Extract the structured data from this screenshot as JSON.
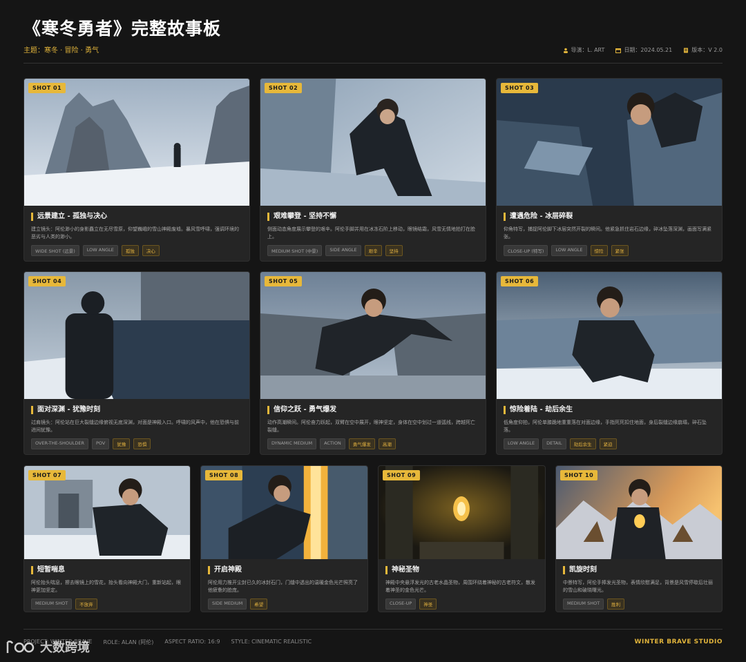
{
  "header": {
    "title": "《寒冬勇者》完整故事板",
    "subtitle": "主题：寒冬 · 冒险 · 勇气",
    "director": "导演：L. ART",
    "date": "日期：2024.05.21",
    "version": "版本：V 2.0"
  },
  "colors": {
    "accent": "#e7b83a",
    "background": "#151515",
    "card": "#252525"
  },
  "shots": [
    {
      "badge": "SHOT 01",
      "title": "远景建立 - 孤独与决心",
      "desc": "建立镜头：阿伦渺小的身影矗立在无尽雪原，仰望巍峨的雪山神殿废墟。暴风雪呼啸，强调环境的恶劣与人类的渺小。",
      "tags": [
        "WIDE SHOT (远景)",
        "LOW ANGLE"
      ],
      "gold": [
        "孤独",
        "决心"
      ]
    },
    {
      "badge": "SHOT 02",
      "title": "艰难攀登 - 坚持不懈",
      "desc": "侧面动态角度展示攀登的艰辛。阿伦手脚并用在冰冻石阶上移动，眼镜结霜，风雪无情地拍打在脸上。",
      "tags": [
        "MEDIUM SHOT (中景)",
        "SIDE ANGLE"
      ],
      "gold": [
        "艰辛",
        "坚持"
      ]
    },
    {
      "badge": "SHOT 03",
      "title": "遭遇危险 - 冰层碎裂",
      "desc": "仰角特写，捕捉阿伦脚下冰层突然开裂的瞬间。他紧急抓住岩石边缘，碎冰坠落深渊，画面写满紧张。",
      "tags": [
        "CLOSE-UP (特写)",
        "LOW ANGLE"
      ],
      "gold": [
        "惊险",
        "紧张"
      ]
    },
    {
      "badge": "SHOT 04",
      "title": "面对深渊 - 犹豫时刻",
      "desc": "过肩镜头：阿伦站在巨大裂缝边缘俯视无底深渊，对面是神殿入口。呼啸的风声中，他在恐惧与前进间犹豫。",
      "tags": [
        "OVER-THE-SHOULDER",
        "POV"
      ],
      "gold": [
        "犹豫",
        "恐惧"
      ]
    },
    {
      "badge": "SHOT 05",
      "title": "信仰之跃 - 勇气爆发",
      "desc": "动作高潮瞬间。阿伦奋力跃起，双臂在空中展开，眼神坚定，身体在空中划过一道弧线，跨越死亡裂缝。",
      "tags": [
        "DYNAMIC MEDIUM",
        "ACTION"
      ],
      "gold": [
        "勇气爆发",
        "高潮"
      ]
    },
    {
      "badge": "SHOT 06",
      "title": "惊险着陆 - 劫后余生",
      "desc": "低角度仰拍，阿伦单膝跪地重重落在对面边缘，手指死死扣住地面，身后裂缝边缘崩塌，碎石坠落。",
      "tags": [
        "LOW ANGLE",
        "DETAIL"
      ],
      "gold": [
        "劫后余生",
        "紧迫"
      ]
    },
    {
      "badge": "SHOT 07",
      "title": "短暂喘息",
      "desc": "阿伦抬头喘息，擦去眼镜上的雪花，抬头看向神殿大门，重新站起，眼神更加坚定。",
      "tags": [
        "MEDIUM SHOT"
      ],
      "gold": [
        "不放弃"
      ]
    },
    {
      "badge": "SHOT 08",
      "title": "开启神殿",
      "desc": "阿伦用力推开尘封已久的冰封石门，门缝中透出的温暖金色光芒照亮了他疲惫的脸庞。",
      "tags": [
        "SIDE MEDIUM"
      ],
      "gold": [
        "希望"
      ]
    },
    {
      "badge": "SHOT 09",
      "title": "神秘圣物",
      "desc": "神殿中央悬浮发光的古老水晶圣物，周围环绕着神秘的古老符文，散发着神圣的金色光芒。",
      "tags": [
        "CLOSE-UP"
      ],
      "gold": [
        "神圣"
      ]
    },
    {
      "badge": "SHOT 10",
      "title": "凯旋时刻",
      "desc": "中景特写，阿伦手捧发光圣物，表情欣慰满足，背景是风雪停歇后壮丽的雪山和破晓曙光。",
      "tags": [
        "MEDIUM SHOT"
      ],
      "gold": [
        "胜利"
      ]
    }
  ],
  "footer": {
    "project": "PROJECT: WINTER BRAVE",
    "role": "ROLE: ALAN (阿伦)",
    "aspect": "ASPECT RATIO: 16:9",
    "style": "STYLE: CINEMATIC REALISTIC",
    "studio": "WINTER BRAVE STUDIO"
  },
  "watermark": "大数跨境"
}
